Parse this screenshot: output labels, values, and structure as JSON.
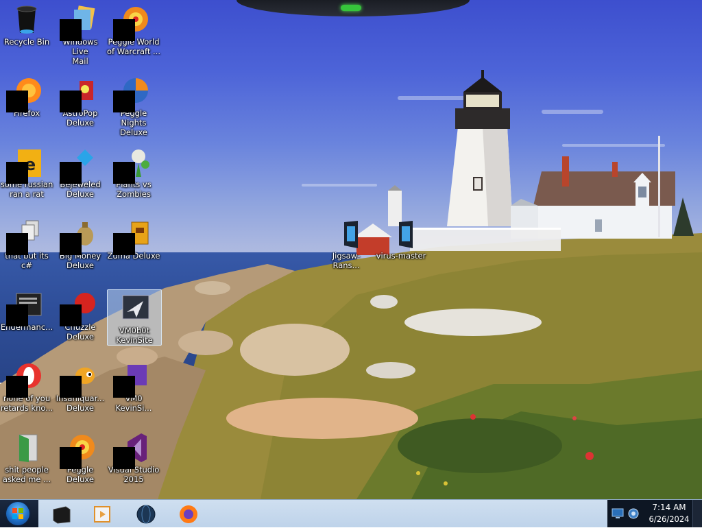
{
  "desktop": {
    "icons": [
      {
        "label": "Recycle Bin",
        "icon": "recycle-bin-icon"
      },
      {
        "label": "Windows Live\nMail",
        "icon": "mail-icon"
      },
      {
        "label": "Peggle World\nof Warcraft ...",
        "icon": "peggle-icon"
      },
      {
        "label": "Firefox",
        "icon": "firefox-icon"
      },
      {
        "label": "AstroPop\nDeluxe",
        "icon": "astropop-icon"
      },
      {
        "label": "Peggle Nights\nDeluxe",
        "icon": "peggle-nights-icon"
      },
      {
        "label": "some russian\nran a rat",
        "icon": "document-icon"
      },
      {
        "label": "Bejeweled\nDeluxe",
        "icon": "bejeweled-icon"
      },
      {
        "label": "Plants vs\nZombies",
        "icon": "plants-icon"
      },
      {
        "label": "that but its c#",
        "icon": "document-icon"
      },
      {
        "label": "Big Money\nDeluxe",
        "icon": "money-bag-icon"
      },
      {
        "label": "Zuma Deluxe",
        "icon": "zuma-icon"
      },
      {
        "label": "Endermanc...",
        "icon": "window-icon"
      },
      {
        "label": "Chuzzle\nDeluxe",
        "icon": "chuzzle-icon"
      },
      {
        "label": "VM0b0t\nKevinSite",
        "icon": "cursor-window-icon"
      },
      {
        "label": "none of you\nretards kno...",
        "icon": "opera-icon"
      },
      {
        "label": "Insaniquar...\nDeluxe",
        "icon": "fish-icon"
      },
      {
        "label": "VM0\nKevinSi...",
        "icon": "window-icon"
      },
      {
        "label": "shit people\nasked me ...",
        "icon": "door-icon"
      },
      {
        "label": "Peggle Deluxe",
        "icon": "peggle-icon"
      },
      {
        "label": "Visual Studio\n2015",
        "icon": "visual-studio-icon"
      },
      {
        "label": "Jigsaw-Rans...",
        "icon": "app-window-icon"
      },
      {
        "label": "virus-master",
        "icon": "app-window-icon"
      }
    ]
  },
  "taskbar": {
    "pinned": [
      {
        "icon": "terminal-box-icon"
      },
      {
        "icon": "media-player-icon"
      },
      {
        "icon": "globe-icon"
      },
      {
        "icon": "firefox-icon"
      }
    ],
    "tray": {
      "icons": [
        {
          "icon": "monitor-icon"
        },
        {
          "icon": "network-icon"
        }
      ]
    },
    "clock": {
      "time": "7:14 AM",
      "date": "6/26/2024"
    }
  },
  "colors": {
    "sky_top": "#3d4fce",
    "taskbar": "#cfdff0",
    "tray": "#0d1623",
    "dock_light": "#36c43b"
  }
}
